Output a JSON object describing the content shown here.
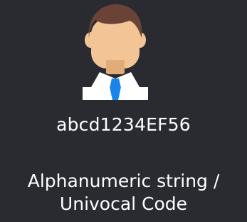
{
  "card": {
    "avatar_icon": "user-avatar-icon",
    "code": "abcd1234EF56",
    "caption_line1": "Alphanumeric string /",
    "caption_line2": "Univocal Code"
  },
  "colors": {
    "background": "#2a2a31",
    "text": "#ffffff",
    "hair": "#6b4336",
    "skin": "#f3c496",
    "shirt": "#ffffff",
    "tie": "#1a84ea"
  }
}
